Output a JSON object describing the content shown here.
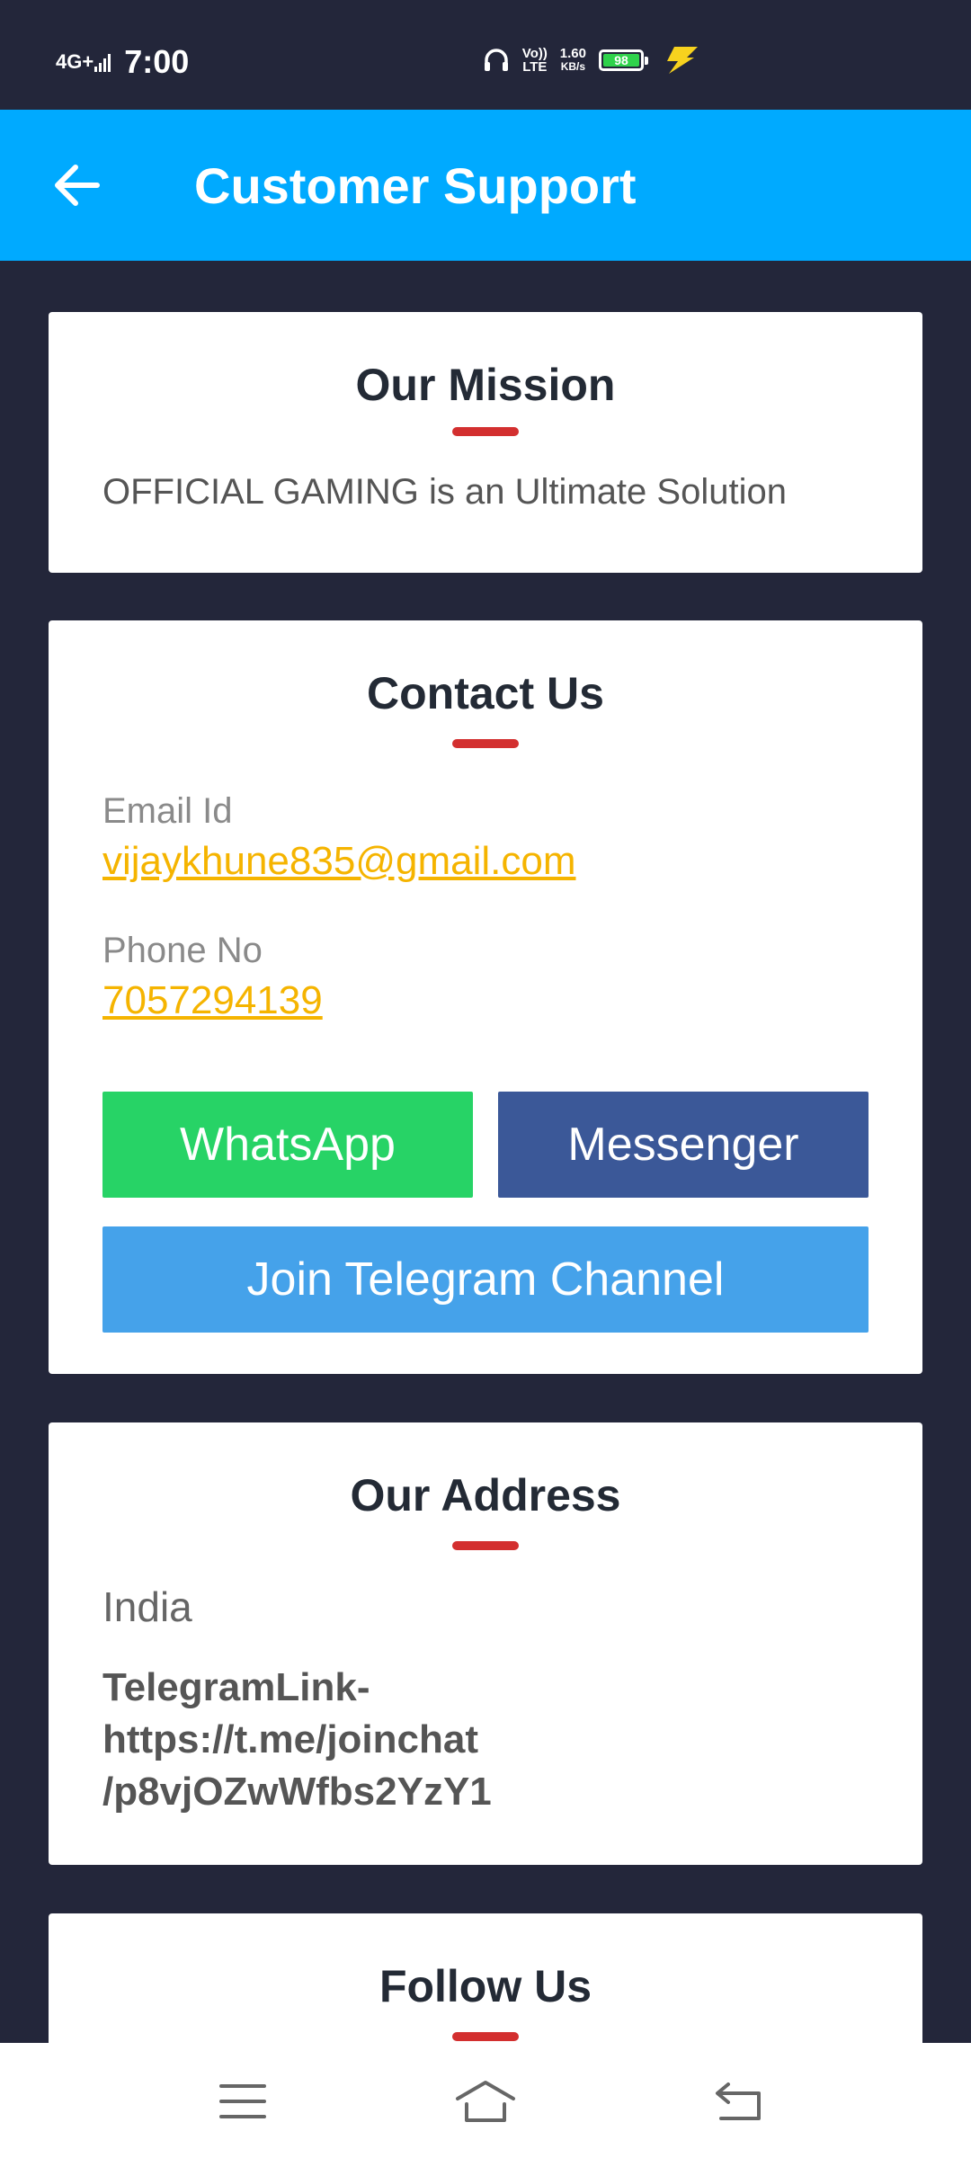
{
  "status_bar": {
    "network": "4G+",
    "time": "7:00",
    "volte": "Vo)) LTE",
    "speed_value": "1.60",
    "speed_unit": "KB/s",
    "battery": "98"
  },
  "app_bar": {
    "title": "Customer Support"
  },
  "mission": {
    "title": "Our Mission",
    "text": "OFFICIAL GAMING is an Ultimate Solution"
  },
  "contact": {
    "title": "Contact Us",
    "email_label": "Email Id",
    "email": "vijaykhune835@gmail.com",
    "phone_label": "Phone No",
    "phone": "7057294139",
    "whatsapp_label": "WhatsApp",
    "messenger_label": "Messenger",
    "telegram_label": "Join Telegram Channel"
  },
  "address": {
    "title": "Our Address",
    "country": "India",
    "link_line1": "TelegramLink-",
    "link_line2": "https://t.me/joinchat",
    "link_line3": "/p8vjOZwWfbs2YzY1"
  },
  "follow": {
    "title": "Follow Us"
  },
  "colors": {
    "app_bar": "#00aaff",
    "background": "#23263a",
    "accent_underline": "#d32f2f",
    "link": "#f5b400",
    "whatsapp": "#27d366",
    "messenger": "#3b5898",
    "telegram": "#45a2ea"
  }
}
